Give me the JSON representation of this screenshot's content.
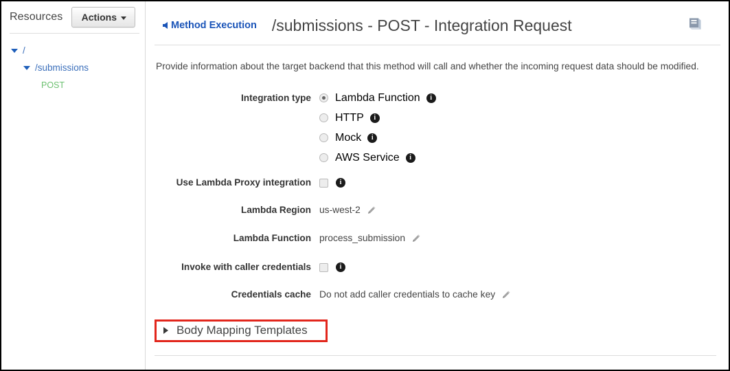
{
  "sidebar": {
    "title": "Resources",
    "actions_button": "Actions",
    "actions_caret_icon": "caret-down-icon",
    "tree": [
      {
        "label": "/",
        "level": 0,
        "expanded": true,
        "kind": "resource",
        "toggle_icon": "triangle-down-icon"
      },
      {
        "label": "/submissions",
        "level": 1,
        "expanded": true,
        "kind": "resource",
        "toggle_icon": "triangle-down-icon"
      },
      {
        "label": "POST",
        "level": 2,
        "expanded": false,
        "kind": "method",
        "toggle_icon": ""
      }
    ]
  },
  "header": {
    "back_link": "Method Execution",
    "back_icon": "arrow-left-icon",
    "title": "/submissions - POST - Integration Request",
    "doc_icon": "book-icon"
  },
  "description": "Provide information about the target backend that this method will call and whether the incoming request data should be modified.",
  "form": {
    "integration_type": {
      "label": "Integration type",
      "selected": "Lambda Function",
      "options": [
        {
          "label": "Lambda Function",
          "checked": true,
          "info_icon": "info-icon"
        },
        {
          "label": "HTTP",
          "checked": false,
          "info_icon": "info-icon"
        },
        {
          "label": "Mock",
          "checked": false,
          "info_icon": "info-icon"
        },
        {
          "label": "AWS Service",
          "checked": false,
          "info_icon": "info-icon"
        }
      ]
    },
    "lambda_proxy": {
      "label": "Use Lambda Proxy integration",
      "checked": false,
      "info_icon": "info-icon"
    },
    "lambda_region": {
      "label": "Lambda Region",
      "value": "us-west-2",
      "edit_icon": "pencil-icon"
    },
    "lambda_function": {
      "label": "Lambda Function",
      "value": "process_submission",
      "edit_icon": "pencil-icon"
    },
    "invoke_with_caller_credentials": {
      "label": "Invoke with caller credentials",
      "checked": false,
      "info_icon": "info-icon"
    },
    "credentials_cache": {
      "label": "Credentials cache",
      "value": "Do not add caller credentials to cache key",
      "edit_icon": "pencil-icon"
    }
  },
  "body_mapping_templates": {
    "title": "Body Mapping Templates",
    "expanded": false,
    "toggle_icon": "triangle-right-icon",
    "highlight_color": "#e2261c"
  },
  "colors": {
    "link_blue": "#1a54b8",
    "tree_blue": "#3b6fbb",
    "method_green": "#6cc070",
    "text_dark": "#444444",
    "highlight_red": "#e2261c"
  }
}
